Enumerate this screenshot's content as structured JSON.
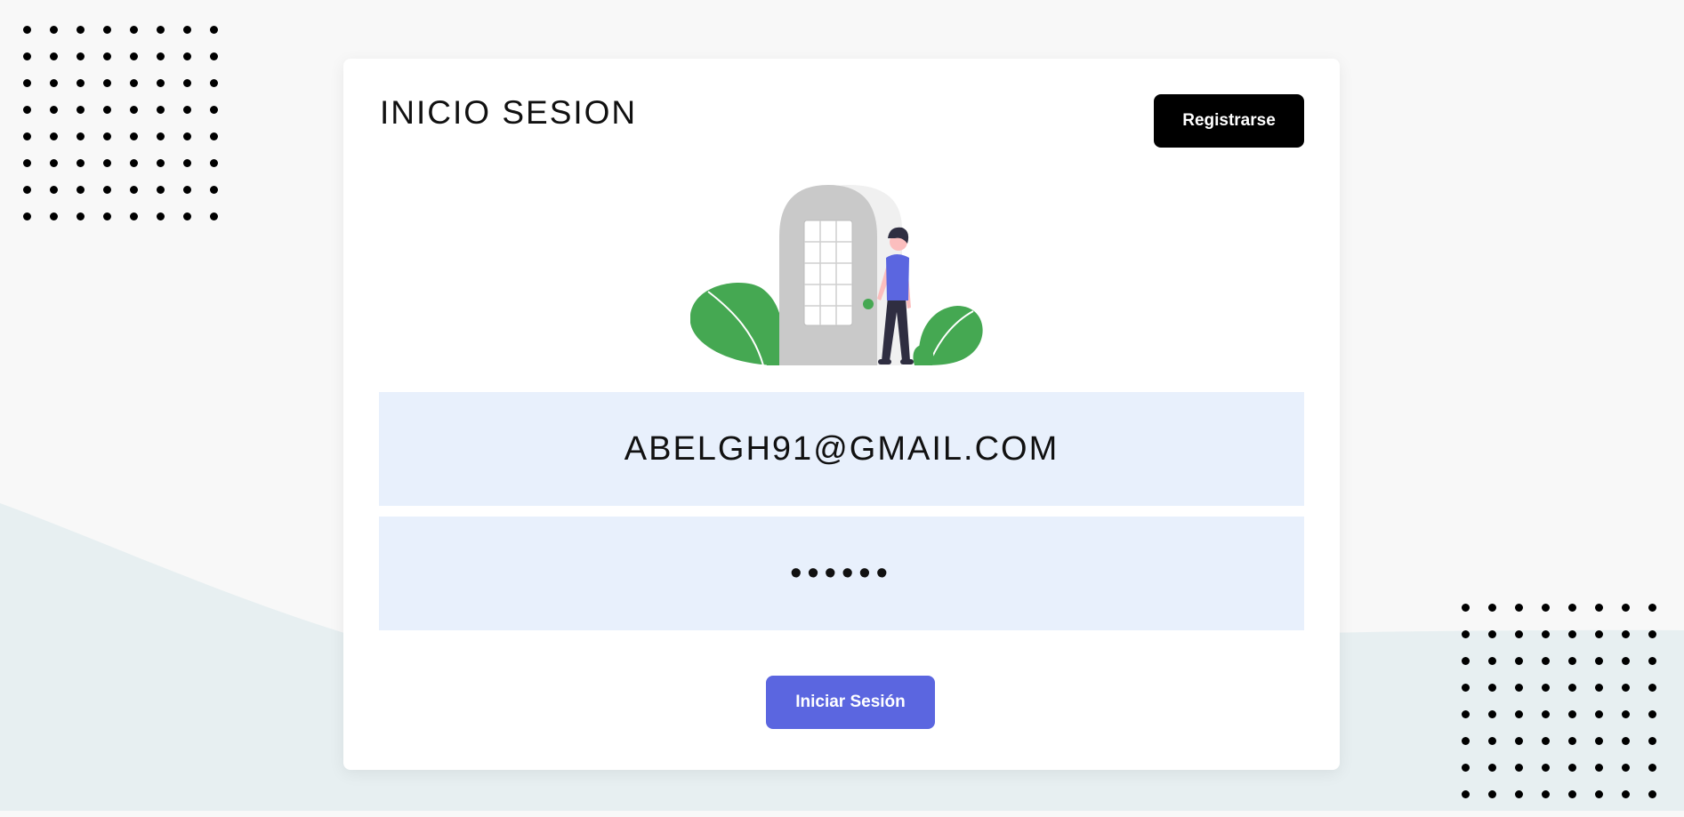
{
  "login": {
    "title": "INICIO SESION",
    "register_label": "Registrarse",
    "email_value": "ABELGH91@GMAIL.COM",
    "password_value": "123456",
    "submit_label": "Iniciar Sesión"
  },
  "colors": {
    "page_background": "#f8f8f8",
    "wave_background": "#e7eff1",
    "field_background": "#e8f0fc",
    "primary_button": "#5b66e0",
    "register_button": "#000000"
  },
  "icons": {
    "illustration": "door-entry-illustration",
    "decoration": "dot-grid-pattern"
  }
}
